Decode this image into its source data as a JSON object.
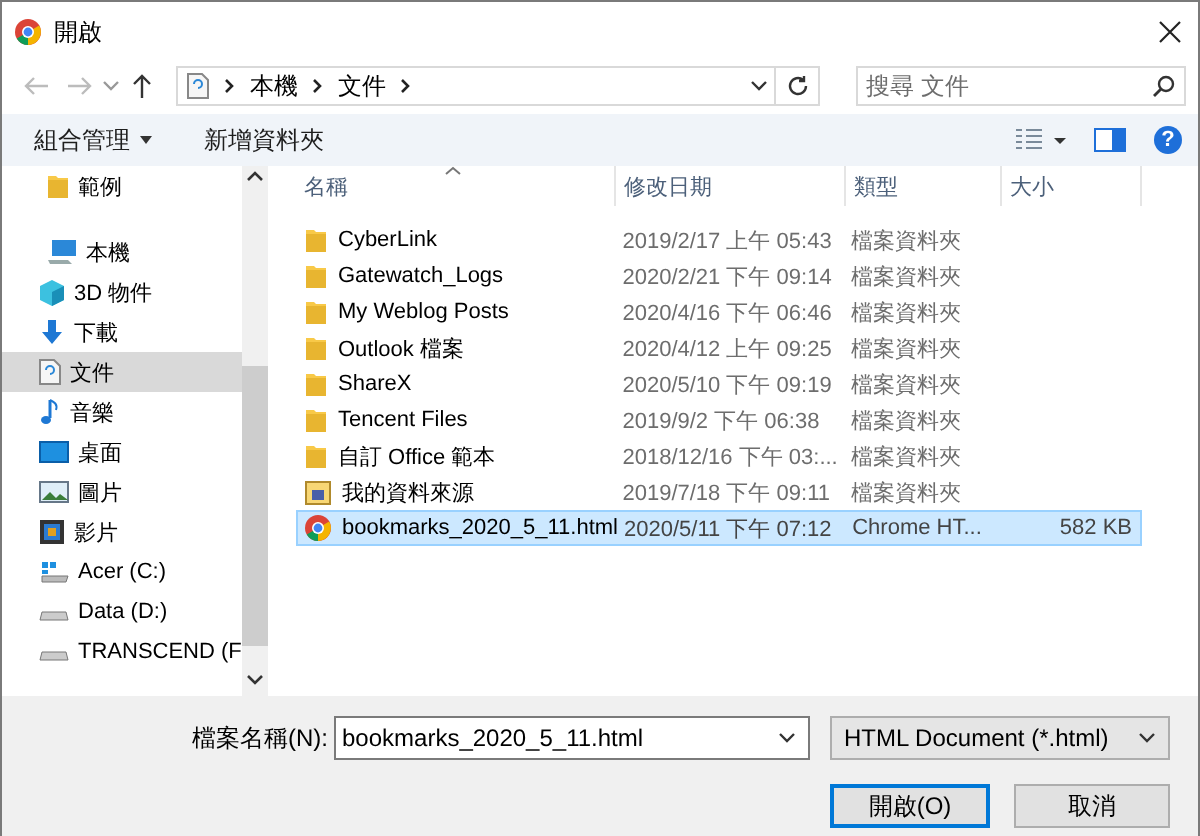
{
  "window": {
    "title": "開啟"
  },
  "nav": {
    "back_disabled": true,
    "forward_disabled": true,
    "path": [
      "本機",
      "文件"
    ],
    "search": {
      "placeholder": "搜尋 文件"
    }
  },
  "toolbar": {
    "buttons": [
      {
        "label": "組合管理",
        "dropdown": true
      },
      {
        "label": "新增資料夾",
        "dropdown": false
      }
    ],
    "help": "?"
  },
  "sidebar": {
    "items": [
      {
        "label": "範例",
        "kind": "folder",
        "selected": false
      },
      {
        "label": "本機",
        "kind": "pc",
        "selected": false,
        "children": [
          {
            "label": "3D 物件",
            "kind": "cube",
            "selected": false
          },
          {
            "label": "下載",
            "kind": "download",
            "selected": false
          },
          {
            "label": "文件",
            "kind": "document",
            "selected": true
          },
          {
            "label": "音樂",
            "kind": "music",
            "selected": false
          },
          {
            "label": "桌面",
            "kind": "desktop",
            "selected": false
          },
          {
            "label": "圖片",
            "kind": "pictures",
            "selected": false
          },
          {
            "label": "影片",
            "kind": "video",
            "selected": false
          },
          {
            "label": "Acer (C:)",
            "kind": "system-drive",
            "selected": false
          },
          {
            "label": "Data (D:)",
            "kind": "drive",
            "selected": false
          },
          {
            "label": "TRANSCEND (F",
            "kind": "drive",
            "selected": false
          }
        ]
      }
    ]
  },
  "table": {
    "columns": [
      {
        "label": "名稱",
        "sorted": true
      },
      {
        "label": "修改日期",
        "sorted": false
      },
      {
        "label": "類型",
        "sorted": false
      },
      {
        "label": "大小",
        "sorted": false
      }
    ],
    "rows": [
      {
        "name": "CyberLink",
        "date": "2019/2/17 上午 05:43",
        "type": "檔案資料夾",
        "size": "",
        "kind": "folder",
        "selected": false
      },
      {
        "name": "Gatewatch_Logs",
        "date": "2020/2/21 下午 09:14",
        "type": "檔案資料夾",
        "size": "",
        "kind": "folder",
        "selected": false
      },
      {
        "name": "My Weblog Posts",
        "date": "2020/4/16 下午 06:46",
        "type": "檔案資料夾",
        "size": "",
        "kind": "folder",
        "selected": false
      },
      {
        "name": "Outlook 檔案",
        "date": "2020/4/12 上午 09:25",
        "type": "檔案資料夾",
        "size": "",
        "kind": "folder",
        "selected": false
      },
      {
        "name": "ShareX",
        "date": "2020/5/10 下午 09:19",
        "type": "檔案資料夾",
        "size": "",
        "kind": "folder",
        "selected": false
      },
      {
        "name": "Tencent Files",
        "date": "2019/9/2 下午 06:38",
        "type": "檔案資料夾",
        "size": "",
        "kind": "folder",
        "selected": false
      },
      {
        "name": "自訂 Office 範本",
        "date": "2018/12/16 下午 03:...",
        "type": "檔案資料夾",
        "size": "",
        "kind": "folder",
        "selected": false
      },
      {
        "name": "我的資料來源",
        "date": "2019/7/18 下午 09:11",
        "type": "檔案資料夾",
        "size": "",
        "kind": "special-folder",
        "selected": false
      },
      {
        "name": "bookmarks_2020_5_11.html",
        "date": "2020/5/11 下午 07:12",
        "type": "Chrome HT...",
        "size": "582 KB",
        "kind": "chrome",
        "selected": true
      }
    ]
  },
  "footer": {
    "filename_label": "檔案名稱(N):",
    "filename": "bookmarks_2020_5_11.html",
    "filetype": "HTML Document (*.html)",
    "buttons": [
      {
        "label": "開啟(O)",
        "kind": "primary"
      },
      {
        "label": "取消",
        "kind": "normal"
      }
    ]
  }
}
